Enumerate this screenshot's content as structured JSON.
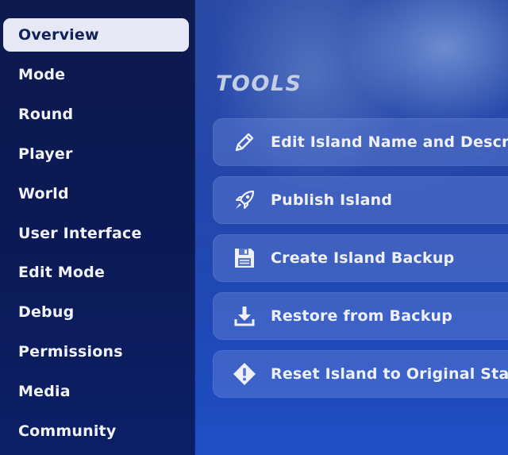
{
  "sidebar": {
    "items": [
      {
        "label": "Overview",
        "active": true
      },
      {
        "label": "Mode"
      },
      {
        "label": "Round"
      },
      {
        "label": "Player"
      },
      {
        "label": "World"
      },
      {
        "label": "User Interface"
      },
      {
        "label": "Edit Mode"
      },
      {
        "label": "Debug"
      },
      {
        "label": "Permissions"
      },
      {
        "label": "Media"
      },
      {
        "label": "Community"
      }
    ]
  },
  "main": {
    "section_title": "TOOLS",
    "tools": [
      {
        "label": "Edit Island Name and Descr",
        "icon": "pencil-icon"
      },
      {
        "label": "Publish Island",
        "icon": "rocket-icon"
      },
      {
        "label": "Create Island Backup",
        "icon": "floppy-disk-icon"
      },
      {
        "label": "Restore from Backup",
        "icon": "download-icon"
      },
      {
        "label": "Reset Island to Original Stat",
        "icon": "warning-icon"
      }
    ]
  },
  "colors": {
    "sidebar_bg": "#0b1a55",
    "active_item_bg": "#e6e9f5",
    "tool_button_bg": "#6e8cdc"
  }
}
